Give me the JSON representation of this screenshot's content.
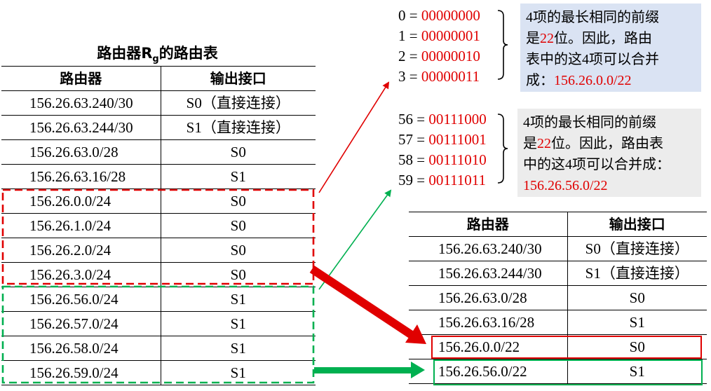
{
  "left_title": {
    "prefix": "路由器R",
    "sub": "g",
    "suffix": "的路由表"
  },
  "headers": {
    "router": "路由器",
    "iface": "输出接口"
  },
  "left_rows": [
    {
      "net": "156.26.63.240/30",
      "iface": "S0（直接连接）"
    },
    {
      "net": "156.26.63.244/30",
      "iface": "S1（直接连接）"
    },
    {
      "net": "156.26.63.0/28",
      "iface": "S0"
    },
    {
      "net": "156.26.63.16/28",
      "iface": "S1"
    },
    {
      "net": "156.26.0.0/24",
      "iface": "S0"
    },
    {
      "net": "156.26.1.0/24",
      "iface": "S0"
    },
    {
      "net": "156.26.2.0/24",
      "iface": "S0"
    },
    {
      "net": "156.26.3.0/24",
      "iface": "S0"
    },
    {
      "net": "156.26.56.0/24",
      "iface": "S1"
    },
    {
      "net": "156.26.57.0/24",
      "iface": "S1"
    },
    {
      "net": "156.26.58.0/24",
      "iface": "S1"
    },
    {
      "net": "156.26.59.0/24",
      "iface": "S1"
    }
  ],
  "right_rows": [
    {
      "net": "156.26.63.240/30",
      "iface": "S0（直接连接）"
    },
    {
      "net": "156.26.63.244/30",
      "iface": "S1（直接连接）"
    },
    {
      "net": "156.26.63.0/28",
      "iface": "S0"
    },
    {
      "net": "156.26.63.16/28",
      "iface": "S1"
    },
    {
      "net": "156.26.0.0/22",
      "iface": "S0"
    },
    {
      "net": "156.26.56.0/22",
      "iface": "S1"
    }
  ],
  "binary_group1": [
    {
      "dec": "0 = ",
      "bin": "00000000"
    },
    {
      "dec": "1 = ",
      "bin": "00000001"
    },
    {
      "dec": "2 = ",
      "bin": "00000010"
    },
    {
      "dec": "3 = ",
      "bin": "00000011"
    }
  ],
  "binary_group2": [
    {
      "dec": "56 = ",
      "bin": "00111000"
    },
    {
      "dec": "57 = ",
      "bin": "00111001"
    },
    {
      "dec": "58 = ",
      "bin": "00111010"
    },
    {
      "dec": "59 = ",
      "bin": "00111011"
    }
  ],
  "box1": {
    "line1_num": "4",
    "line1_text": "项的最长相同的前缀",
    "line2_a": "是",
    "line2_num": "22",
    "line2_b": "位。因此，路由",
    "line3_a": "表中的这",
    "line3_num": "4",
    "line3_b": "项可以合并",
    "line4_a": "成：",
    "line4_net": "156.26.0.0/22"
  },
  "box2": {
    "line1_num": "4",
    "line1_text": "项的最长相同的前缀",
    "line2_a": "是",
    "line2_num": "22",
    "line2_b": "位。因此，路由表",
    "line3_a": "中的这",
    "line3_num": "4",
    "line3_b": "项可以合并成：",
    "line4_net": "156.26.56.0/22"
  },
  "colors": {
    "red": "#e00000",
    "green": "#00b050",
    "box1_bg": "#dae3f3",
    "box2_bg": "#ececec"
  }
}
